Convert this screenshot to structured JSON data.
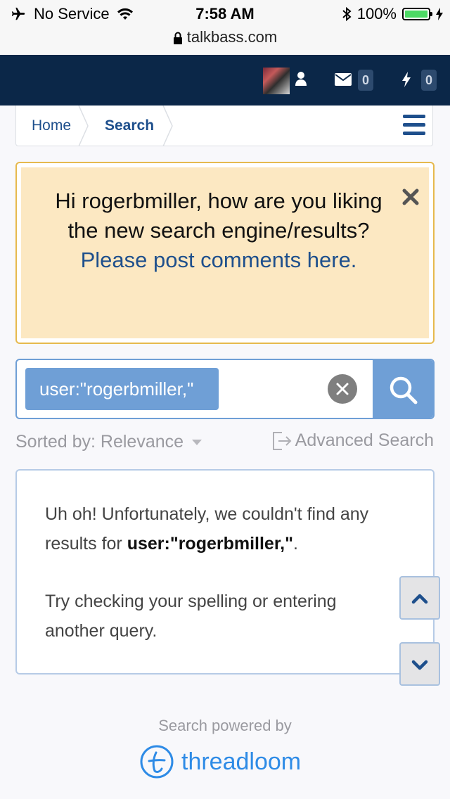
{
  "status_bar": {
    "carrier": "No Service",
    "time": "7:58 AM",
    "battery": "100%",
    "battery_level": 1.0
  },
  "browser": {
    "url": "talkbass.com"
  },
  "top_nav": {
    "messages_count": "0",
    "alerts_count": "0"
  },
  "breadcrumb": {
    "items": [
      "Home",
      "Search"
    ]
  },
  "notice": {
    "text": "Hi rogerbmiller, how are you liking the new search engine/results? ",
    "link_text": "Please post comments here."
  },
  "search": {
    "query_chip": "user:\"rogerbmiller,\""
  },
  "sort": {
    "label": "Sorted by: Relevance",
    "advanced_label": "Advanced Search"
  },
  "results": {
    "line1_prefix": "Uh oh! Unfortunately, we couldn't find any results for ",
    "line1_query": "user:\"rogerbmiller,\"",
    "line1_suffix": ".",
    "line2": "Try checking your spelling or entering another query."
  },
  "footer": {
    "powered_by": "Search powered by",
    "brand": "threadloom"
  },
  "colors": {
    "nav_bg": "#0b2748",
    "link_blue": "#1e4f8c",
    "notice_bg": "#fce8c2",
    "notice_border": "#e6b94d",
    "search_accent": "#6f9fd6",
    "brand_blue": "#2e8be6",
    "battery_green": "#4cd964"
  }
}
